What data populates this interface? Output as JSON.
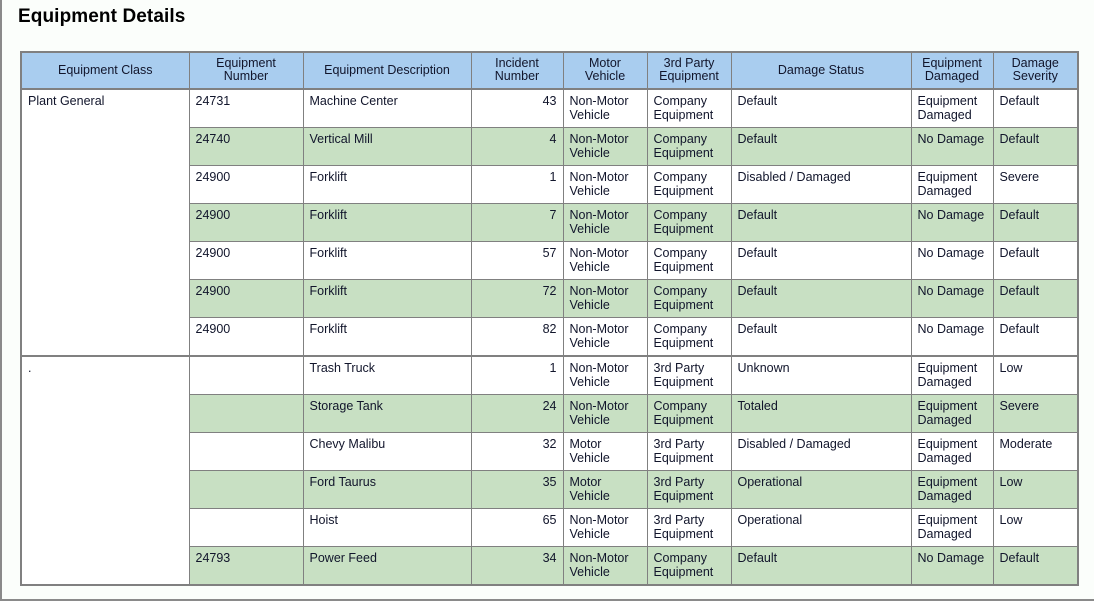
{
  "page": {
    "title": "Equipment Details",
    "colors": {
      "header_blue": "#a9cdef",
      "alt_row_green": "#c8e0c3",
      "border_gray": "#808080",
      "background": "#fbfefb"
    }
  },
  "table": {
    "columns": [
      "Equipment Class",
      "Equipment Number",
      "Equipment Description",
      "Incident Number",
      "Motor Vehicle",
      "3rd Party Equipment",
      "Damage Status",
      "Equipment Damaged",
      "Damage Severity"
    ],
    "column_lines": [
      [
        "Equipment Class"
      ],
      [
        "Equipment",
        "Number"
      ],
      [
        "Equipment Description"
      ],
      [
        "Incident",
        "Number"
      ],
      [
        "Motor Vehicle"
      ],
      [
        "3rd Party",
        "Equipment"
      ],
      [
        "Damage Status"
      ],
      [
        "Equipment",
        "Damaged"
      ],
      [
        "Damage",
        "Severity"
      ]
    ],
    "groups": [
      {
        "equipment_class": "Plant General",
        "rows": [
          {
            "equipment_number": "24731",
            "equipment_description": "Machine Center",
            "incident_number": "43",
            "motor_vehicle": "Non-Motor Vehicle",
            "third_party_equipment": "Company Equipment",
            "damage_status": "Default",
            "equipment_damaged": "Equipment Damaged",
            "damage_severity": "Default",
            "alt": false
          },
          {
            "equipment_number": "24740",
            "equipment_description": "Vertical Mill",
            "incident_number": "4",
            "motor_vehicle": "Non-Motor Vehicle",
            "third_party_equipment": "Company Equipment",
            "damage_status": "Default",
            "equipment_damaged": "No Damage",
            "damage_severity": "Default",
            "alt": true
          },
          {
            "equipment_number": "24900",
            "equipment_description": "Forklift",
            "incident_number": "1",
            "motor_vehicle": "Non-Motor Vehicle",
            "third_party_equipment": "Company Equipment",
            "damage_status": "Disabled / Damaged",
            "equipment_damaged": "Equipment Damaged",
            "damage_severity": "Severe",
            "alt": false
          },
          {
            "equipment_number": "24900",
            "equipment_description": "Forklift",
            "incident_number": "7",
            "motor_vehicle": "Non-Motor Vehicle",
            "third_party_equipment": "Company Equipment",
            "damage_status": "Default",
            "equipment_damaged": "No Damage",
            "damage_severity": "Default",
            "alt": true
          },
          {
            "equipment_number": "24900",
            "equipment_description": "Forklift",
            "incident_number": "57",
            "motor_vehicle": "Non-Motor Vehicle",
            "third_party_equipment": "Company Equipment",
            "damage_status": "Default",
            "equipment_damaged": "No Damage",
            "damage_severity": "Default",
            "alt": false
          },
          {
            "equipment_number": "24900",
            "equipment_description": "Forklift",
            "incident_number": "72",
            "motor_vehicle": "Non-Motor Vehicle",
            "third_party_equipment": "Company Equipment",
            "damage_status": "Default",
            "equipment_damaged": "No Damage",
            "damage_severity": "Default",
            "alt": true
          },
          {
            "equipment_number": "24900",
            "equipment_description": "Forklift",
            "incident_number": "82",
            "motor_vehicle": "Non-Motor Vehicle",
            "third_party_equipment": "Company Equipment",
            "damage_status": "Default",
            "equipment_damaged": "No Damage",
            "damage_severity": "Default",
            "alt": false
          }
        ]
      },
      {
        "equipment_class": ".",
        "rows": [
          {
            "equipment_number": "",
            "equipment_description": "Trash Truck",
            "incident_number": "1",
            "motor_vehicle": "Non-Motor Vehicle",
            "third_party_equipment": "3rd Party Equipment",
            "damage_status": "Unknown",
            "equipment_damaged": "Equipment Damaged",
            "damage_severity": "Low",
            "alt": false
          },
          {
            "equipment_number": "",
            "equipment_description": "Storage Tank",
            "incident_number": "24",
            "motor_vehicle": "Non-Motor Vehicle",
            "third_party_equipment": "Company Equipment",
            "damage_status": "Totaled",
            "equipment_damaged": "Equipment Damaged",
            "damage_severity": "Severe",
            "alt": true
          },
          {
            "equipment_number": "",
            "equipment_description": "Chevy Malibu",
            "incident_number": "32",
            "motor_vehicle": "Motor Vehicle",
            "third_party_equipment": "3rd Party Equipment",
            "damage_status": "Disabled / Damaged",
            "equipment_damaged": "Equipment Damaged",
            "damage_severity": "Moderate",
            "alt": false
          },
          {
            "equipment_number": "",
            "equipment_description": "Ford Taurus",
            "incident_number": "35",
            "motor_vehicle": "Motor Vehicle",
            "third_party_equipment": "3rd Party Equipment",
            "damage_status": "Operational",
            "equipment_damaged": "Equipment Damaged",
            "damage_severity": "Low",
            "alt": true
          },
          {
            "equipment_number": "",
            "equipment_description": "Hoist",
            "incident_number": "65",
            "motor_vehicle": "Non-Motor Vehicle",
            "third_party_equipment": "3rd Party Equipment",
            "damage_status": "Operational",
            "equipment_damaged": "Equipment Damaged",
            "damage_severity": "Low",
            "alt": false
          },
          {
            "equipment_number": "24793",
            "equipment_description": "Power Feed",
            "incident_number": "34",
            "motor_vehicle": "Non-Motor Vehicle",
            "third_party_equipment": "Company Equipment",
            "damage_status": "Default",
            "equipment_damaged": "No Damage",
            "damage_severity": "Default",
            "alt": true
          }
        ]
      }
    ]
  }
}
